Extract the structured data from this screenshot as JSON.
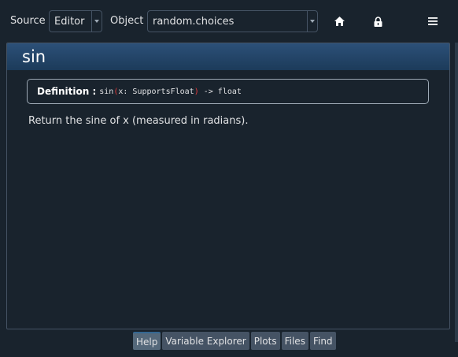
{
  "toolbar": {
    "source_label": "Source",
    "source_value": "Editor",
    "object_label": "Object",
    "object_value": "random.choices",
    "icons": [
      "home-icon",
      "lock-icon",
      "menu-icon"
    ]
  },
  "help": {
    "title": "sin",
    "definition_label": "Definition :",
    "signature": {
      "name": "sin",
      "open": "(",
      "params": "x: SupportsFloat",
      "close": ")",
      "returns": " -> float"
    },
    "description": "Return the sine of x (measured in radians)."
  },
  "tabs": [
    {
      "label": "Help",
      "active": true
    },
    {
      "label": "Variable Explorer",
      "active": false
    },
    {
      "label": "Plots",
      "active": false
    },
    {
      "label": "Files",
      "active": false
    },
    {
      "label": "Find",
      "active": false
    }
  ],
  "colors": {
    "background": "#19232d",
    "header_gradient_top": "#2c5078",
    "paren": "#e53939",
    "border": "#455364"
  }
}
